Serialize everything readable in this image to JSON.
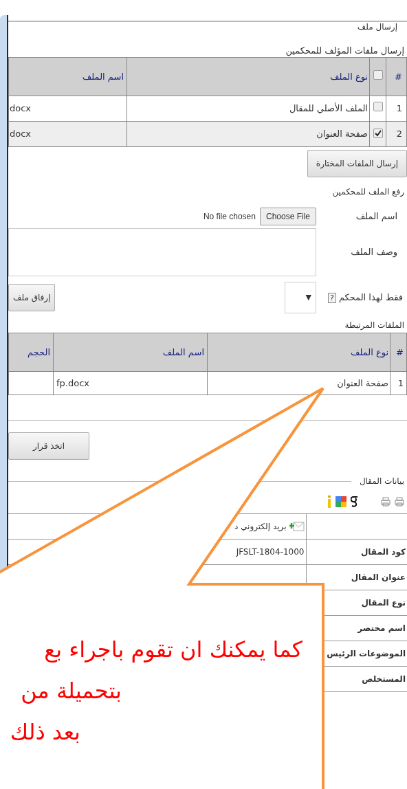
{
  "section_title": "إرسال ملف",
  "author_files": {
    "title": "إرسال ملفات المؤلف للمحكمين",
    "header_checked": false,
    "columns": {
      "number": "#",
      "file_type": "نوع الملف",
      "file_name": "اسم الملف"
    },
    "rows": [
      {
        "number": "1",
        "checked": false,
        "file_type": "الملف الأصلي للمقال",
        "file_name": "docx"
      },
      {
        "number": "2",
        "checked": true,
        "file_type": "صفحة العنوان",
        "file_name": "docx"
      }
    ]
  },
  "send_button": "إرسال الملفات المختارة",
  "upload": {
    "title": "رفع الملف للمحكمين",
    "name_label": "اسم الملف",
    "choose_button": "Choose File",
    "no_file": "No file chosen",
    "description_label": "وصف الملف",
    "reviewer_label": "فقط لهذا المحكم",
    "help": "?",
    "select_arrow": "▼",
    "attach_button": "إرفاق ملف"
  },
  "related_files": {
    "title": "الملفات المرتبطة",
    "columns": {
      "number": "#",
      "file_type": "نوع الملف",
      "file_name": "اسم الملف",
      "size": "الحجم"
    },
    "rows": [
      {
        "number": "1",
        "file_type": "صفحة العنوان",
        "file_name": "fp.docx"
      }
    ]
  },
  "decision_button": "اتخذ قرار",
  "article": {
    "legend": "بيانات المقال",
    "rows": [
      {
        "kind": "email",
        "label": "",
        "value": "بريد إلكتروني د"
      },
      {
        "kind": "field",
        "label": "كود المقال",
        "value": "JFSLT-1804-1000"
      },
      {
        "kind": "field",
        "label": "عنوان المقال",
        "value": ""
      },
      {
        "kind": "field",
        "label": "نوع المقال",
        "value": ""
      },
      {
        "kind": "field",
        "label": "اسم مختصر",
        "value": ""
      },
      {
        "kind": "field",
        "label": "الموضوعات الرئيس",
        "value": ""
      },
      {
        "kind": "field",
        "label": "المستخلص",
        "value": ""
      }
    ]
  },
  "callout": {
    "lines": [
      "كما يمكنك ان تقوم باجراء بع",
      "بتحميلة من",
      "بعد ذلك"
    ]
  }
}
